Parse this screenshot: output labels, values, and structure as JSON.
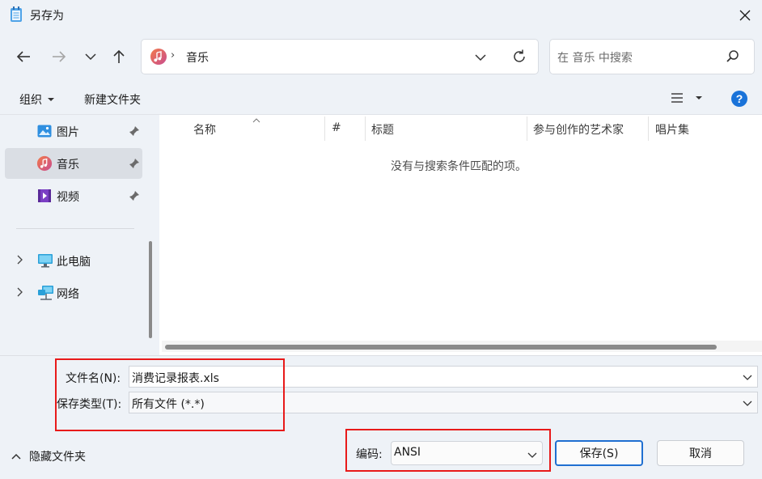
{
  "window": {
    "title": "另存为"
  },
  "nav": {
    "address_crumb": "音乐",
    "search_placeholder": "在 音乐 中搜索"
  },
  "toolbar": {
    "organize_label": "组织",
    "new_folder_label": "新建文件夹"
  },
  "sidebar": {
    "items": [
      {
        "label": "图片",
        "icon": "pictures-icon",
        "pinned": true
      },
      {
        "label": "音乐",
        "icon": "music-icon",
        "pinned": true,
        "selected": true
      },
      {
        "label": "视频",
        "icon": "videos-icon",
        "pinned": true
      },
      {
        "label": "此电脑",
        "icon": "this-pc-icon"
      },
      {
        "label": "网络",
        "icon": "network-icon"
      }
    ]
  },
  "list": {
    "columns": [
      "名称",
      "#",
      "标题",
      "参与创作的艺术家",
      "唱片集"
    ],
    "empty_message": "没有与搜索条件匹配的项。"
  },
  "form": {
    "filename_label": "文件名(N):",
    "filename_value": "消费记录报表.xls",
    "filetype_label": "保存类型(T):",
    "filetype_value": "所有文件  (*.*)",
    "encoding_label": "编码:",
    "encoding_value": "ANSI",
    "hide_folders_label": "隐藏文件夹",
    "save_label": "保存(S)",
    "cancel_label": "取消"
  },
  "colors": {
    "highlight_box": "#e81a1a",
    "accent": "#1f6fd1",
    "help": "#1a73d9"
  }
}
